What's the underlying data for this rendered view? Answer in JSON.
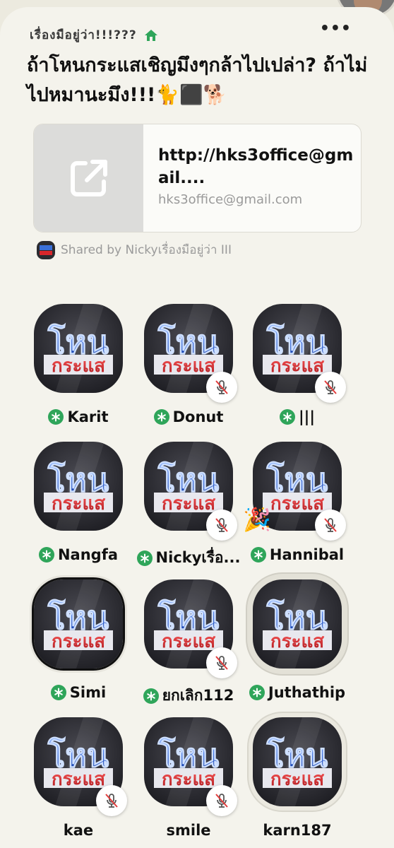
{
  "room": {
    "club_name": "เรื่องมือยู่ว่า!!!???",
    "more_label": "•••",
    "title": "ถ้าโหนกระแสเชิญมึงๆกล้าไปเปล่า? ถ้าไม่ไปหมานะมึง!!!🐈⬛🐕",
    "link_card": {
      "title": "http://hks3office@gmail....",
      "subtitle": "hks3office@gmail.com",
      "icon": "external-link-icon"
    },
    "shared_by": "Shared by Nickyเรื่องมือยู่ว่า III"
  },
  "speakers": [
    {
      "name": "Karit",
      "moderator": true,
      "muted": false,
      "party": false,
      "frame": "none"
    },
    {
      "name": "Donut",
      "moderator": true,
      "muted": true,
      "party": false,
      "frame": "none"
    },
    {
      "name": "|||",
      "moderator": true,
      "muted": true,
      "party": false,
      "frame": "none"
    },
    {
      "name": "Nangfa",
      "moderator": true,
      "muted": false,
      "party": false,
      "frame": "none"
    },
    {
      "name": "Nickyเรื่อ...",
      "moderator": true,
      "muted": true,
      "party": false,
      "frame": "none"
    },
    {
      "name": "Hannibal",
      "moderator": true,
      "muted": true,
      "party": true,
      "frame": "none"
    },
    {
      "name": "Simi",
      "moderator": true,
      "muted": false,
      "party": false,
      "frame": "outlined"
    },
    {
      "name": "ยกเลิก112",
      "moderator": true,
      "muted": true,
      "party": false,
      "frame": "none"
    },
    {
      "name": "Juthathip",
      "moderator": true,
      "muted": false,
      "party": false,
      "frame": "ringed"
    },
    {
      "name": "kae",
      "moderator": false,
      "muted": true,
      "party": false,
      "frame": "none"
    },
    {
      "name": "smile",
      "moderator": false,
      "muted": true,
      "party": false,
      "frame": "none"
    },
    {
      "name": "karn187",
      "moderator": false,
      "muted": false,
      "party": false,
      "frame": "ringed-light"
    }
  ],
  "logo_text": {
    "top": "โหน",
    "bottom": "กระแส"
  },
  "colors": {
    "moderator_green": "#2fa55a",
    "background": "#f4f3ec",
    "logo_blue": "#3a6fd8",
    "logo_red": "#d8262b"
  }
}
